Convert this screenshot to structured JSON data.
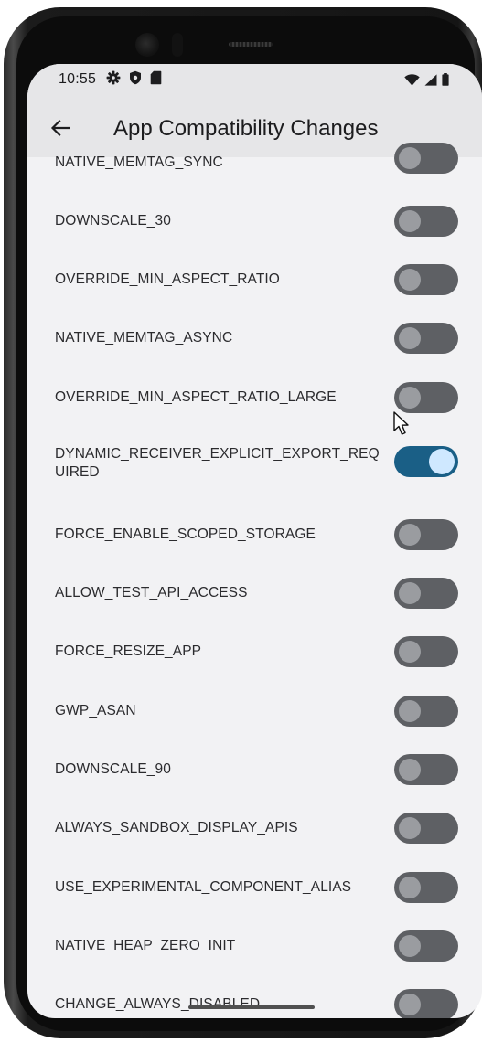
{
  "status_bar": {
    "time": "10:55",
    "left_icons": [
      "settings-gear-icon",
      "shield-icon",
      "sd-card-icon"
    ],
    "right_icons": [
      "wifi-icon",
      "signal-icon",
      "battery-icon"
    ]
  },
  "app_bar": {
    "back_icon": "arrow-back-icon",
    "title": "App Compatibility Changes"
  },
  "colors": {
    "switch_on_track": "#1a5f86",
    "switch_on_knob": "#cfe8ff",
    "switch_off_track": "#5e6064",
    "switch_off_knob": "#9a9ca0",
    "screen_bg": "#f2f2f4",
    "app_bar_bg": "#e6e6e8"
  },
  "changes": [
    {
      "label": "NATIVE_MEMTAG_SYNC",
      "enabled": false
    },
    {
      "label": "DOWNSCALE_30",
      "enabled": false
    },
    {
      "label": "OVERRIDE_MIN_ASPECT_RATIO",
      "enabled": false
    },
    {
      "label": "NATIVE_MEMTAG_ASYNC",
      "enabled": false
    },
    {
      "label": "OVERRIDE_MIN_ASPECT_RATIO_LARGE",
      "enabled": false
    },
    {
      "label": "DYNAMIC_RECEIVER_EXPLICIT_EXPORT_REQUIRED",
      "enabled": true
    },
    {
      "label": "FORCE_ENABLE_SCOPED_STORAGE",
      "enabled": false
    },
    {
      "label": "ALLOW_TEST_API_ACCESS",
      "enabled": false
    },
    {
      "label": "FORCE_RESIZE_APP",
      "enabled": false
    },
    {
      "label": "GWP_ASAN",
      "enabled": false
    },
    {
      "label": "DOWNSCALE_90",
      "enabled": false
    },
    {
      "label": "ALWAYS_SANDBOX_DISPLAY_APIS",
      "enabled": false
    },
    {
      "label": "USE_EXPERIMENTAL_COMPONENT_ALIAS",
      "enabled": false
    },
    {
      "label": "NATIVE_HEAP_ZERO_INIT",
      "enabled": false
    },
    {
      "label": "CHANGE_ALWAYS_DISABLED",
      "enabled": false
    }
  ]
}
